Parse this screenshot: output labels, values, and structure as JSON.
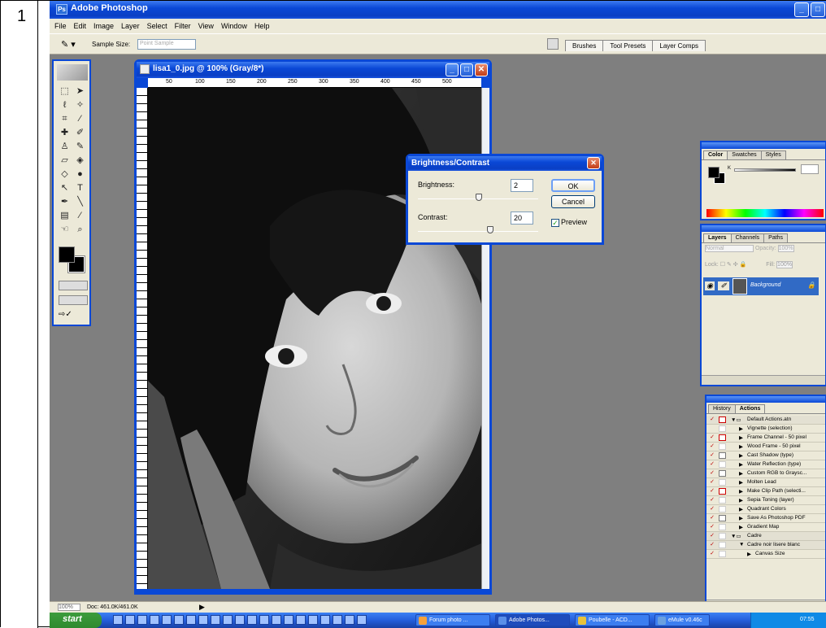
{
  "step_number": "1",
  "app": {
    "title": "Adobe Photoshop",
    "menu": [
      "File",
      "Edit",
      "Image",
      "Layer",
      "Select",
      "Filter",
      "View",
      "Window",
      "Help"
    ],
    "window_buttons": [
      "_",
      "□"
    ]
  },
  "options_bar": {
    "sample_size_label": "Sample Size:",
    "sample_size_value": "Point Sample",
    "palette_well_tabs": [
      "Brushes",
      "Tool Presets",
      "Layer Comps"
    ]
  },
  "document": {
    "title": "lisa1_0.jpg @ 100% (Gray/8*)",
    "ruler_ticks": [
      "50",
      "100",
      "150",
      "200",
      "250",
      "300",
      "350",
      "400",
      "450",
      "500"
    ],
    "status_zoom": "100%",
    "status_doc": "Doc: 461.0K/461.0K"
  },
  "dialog": {
    "title": "Brightness/Contrast",
    "brightness_label": "Brightness:",
    "brightness_value": "2",
    "contrast_label": "Contrast:",
    "contrast_value": "20",
    "brightness_level": 2,
    "contrast_level": 20,
    "ok_label": "OK",
    "cancel_label": "Cancel",
    "preview_label": "Preview",
    "preview_checked": true
  },
  "color_palette": {
    "tabs": [
      "Color",
      "Swatches",
      "Styles"
    ],
    "active_tab": "Color",
    "channel_label": "K"
  },
  "layers_palette": {
    "tabs": [
      "Layers",
      "Channels",
      "Paths"
    ],
    "active_tab": "Layers",
    "blend_mode": "Normal",
    "opacity_label": "Opacity:",
    "opacity_value": "100%",
    "lock_label": "Lock:",
    "fill_label": "Fill:",
    "fill_value": "100%",
    "layer_name": "Background"
  },
  "actions_palette": {
    "tabs": [
      "History",
      "Actions"
    ],
    "active_tab": "Actions",
    "items": [
      {
        "label": "Default Actions.atn",
        "check": "✓",
        "box": "red",
        "indent": 0,
        "kind": "folder"
      },
      {
        "label": "Vignette (selection)",
        "check": "",
        "box": "none",
        "indent": 1,
        "kind": "action"
      },
      {
        "label": "Frame Channel - 50 pixel",
        "check": "✓",
        "box": "red",
        "indent": 1,
        "kind": "action"
      },
      {
        "label": "Wood Frame - 50 pixel",
        "check": "✓",
        "box": "none",
        "indent": 1,
        "kind": "action"
      },
      {
        "label": "Cast Shadow (type)",
        "check": "✓",
        "box": "gray",
        "indent": 1,
        "kind": "action"
      },
      {
        "label": "Water Reflection (type)",
        "check": "✓",
        "box": "none",
        "indent": 1,
        "kind": "action"
      },
      {
        "label": "Custom RGB to Graysc...",
        "check": "✓",
        "box": "gray",
        "indent": 1,
        "kind": "action"
      },
      {
        "label": "Molten Lead",
        "check": "✓",
        "box": "none",
        "indent": 1,
        "kind": "action"
      },
      {
        "label": "Make Clip Path (selecti...",
        "check": "✓",
        "box": "red",
        "indent": 1,
        "kind": "action"
      },
      {
        "label": "Sepia Toning (layer)",
        "check": "✓",
        "box": "none",
        "indent": 1,
        "kind": "action"
      },
      {
        "label": "Quadrant Colors",
        "check": "✓",
        "box": "none",
        "indent": 1,
        "kind": "action"
      },
      {
        "label": "Save As Photoshop PDF",
        "check": "✓",
        "box": "gray",
        "indent": 1,
        "kind": "action"
      },
      {
        "label": "Gradient Map",
        "check": "✓",
        "box": "none",
        "indent": 1,
        "kind": "action"
      },
      {
        "label": "Cadre",
        "check": "✓",
        "box": "none",
        "indent": 0,
        "kind": "folder"
      },
      {
        "label": "Cadre noir lisere blanc",
        "check": "✓",
        "box": "none",
        "indent": 1,
        "kind": "open"
      },
      {
        "label": "Canvas Size",
        "check": "✓",
        "box": "none",
        "indent": 2,
        "kind": "action"
      }
    ]
  },
  "taskbar": {
    "start_label": "start",
    "tasks": [
      "Forum photo ...",
      "Adobe Photos...",
      "Poubelle - ACD...",
      "eMule v0.46c"
    ],
    "active_task": "Adobe Photos...",
    "clock": "07:55"
  },
  "colors": {
    "xp_blue": "#0a48d6",
    "dialog_face": "#ece9d8",
    "workspace_gray": "#7f7f7f",
    "selection_blue": "#316ac5"
  }
}
